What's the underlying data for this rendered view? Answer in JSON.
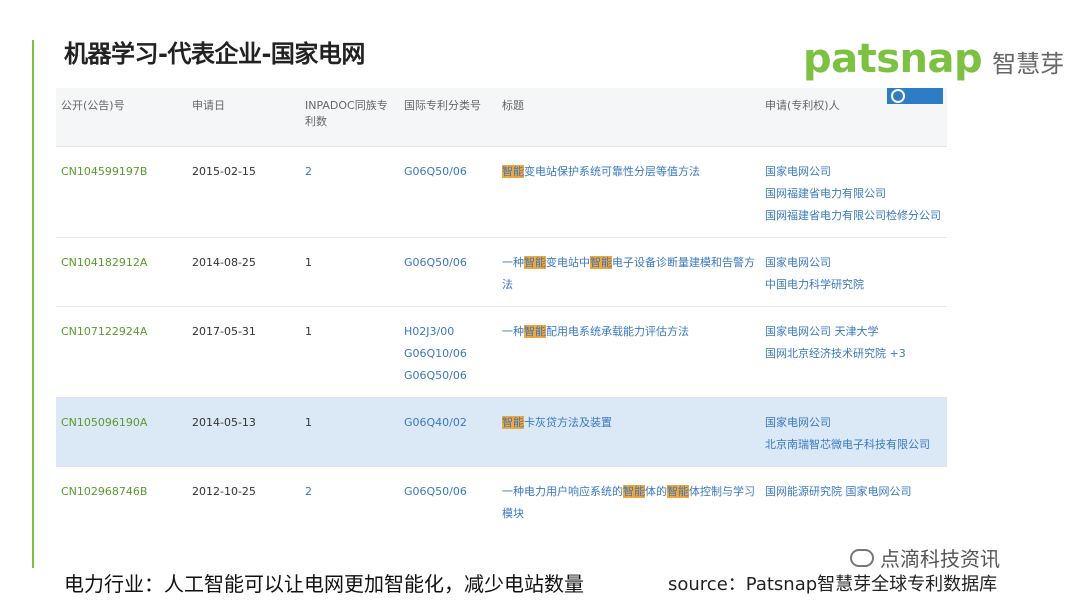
{
  "title": "机器学习-代表企业-国家电网",
  "logo": {
    "word": "patsnap",
    "cn": "智慧芽"
  },
  "table": {
    "headers": [
      "公开(公告)号",
      "申请日",
      "INPADOC同族专利数",
      "国际专利分类号",
      "标题",
      "申请(专利权)人"
    ],
    "rows": [
      {
        "pub": "CN104599197B",
        "date": "2015-02-15",
        "count": "2",
        "ipc": [
          "G06Q50/06"
        ],
        "title_parts": [
          {
            "hl": true,
            "t": "智能"
          },
          {
            "hl": false,
            "t": "变电站保护系统可靠性分层等值方法"
          }
        ],
        "applicants": [
          "国家电网公司",
          "国网福建省电力有限公司",
          "国网福建省电力有限公司检修分公司"
        ]
      },
      {
        "pub": "CN104182912A",
        "date": "2014-08-25",
        "count": "1",
        "ipc": [
          "G06Q50/06"
        ],
        "title_parts": [
          {
            "hl": false,
            "t": "一种"
          },
          {
            "hl": true,
            "t": "智能"
          },
          {
            "hl": false,
            "t": "变电站中"
          },
          {
            "hl": true,
            "t": "智能"
          },
          {
            "hl": false,
            "t": "电子设备诊断量建模和告警方法"
          }
        ],
        "applicants": [
          "国家电网公司",
          "中国电力科学研究院"
        ]
      },
      {
        "pub": "CN107122924A",
        "date": "2017-05-31",
        "count": "1",
        "ipc": [
          "H02J3/00",
          "G06Q10/06",
          "G06Q50/06"
        ],
        "title_parts": [
          {
            "hl": false,
            "t": "一种"
          },
          {
            "hl": true,
            "t": "智能"
          },
          {
            "hl": false,
            "t": "配用电系统承载能力评估方法"
          }
        ],
        "applicants": [
          "国家电网公司 天津大学",
          "国网北京经济技术研究院 +3"
        ]
      },
      {
        "pub": "CN105096190A",
        "date": "2014-05-13",
        "count": "1",
        "ipc": [
          "G06Q40/02"
        ],
        "title_parts": [
          {
            "hl": true,
            "t": "智能"
          },
          {
            "hl": false,
            "t": "卡灰贷方法及装置"
          }
        ],
        "applicants": [
          "国家电网公司",
          "北京南瑞智芯微电子科技有限公司"
        ],
        "highlight": true
      },
      {
        "pub": "CN102968746B",
        "date": "2012-10-25",
        "count": "2",
        "ipc": [
          "G06Q50/06"
        ],
        "title_parts": [
          {
            "hl": false,
            "t": "一种电力用户响应系统的"
          },
          {
            "hl": true,
            "t": "智能"
          },
          {
            "hl": false,
            "t": "体的"
          },
          {
            "hl": true,
            "t": "智能"
          },
          {
            "hl": false,
            "t": "体控制与学习模块"
          }
        ],
        "applicants": [
          "国网能源研究院 国家电网公司"
        ]
      }
    ]
  },
  "caption": "电力行业：人工智能可以让电网更加智能化，减少电站数量",
  "source": "source：Patsnap智慧芽全球专利数据库",
  "watermark": {
    "wechat": "点滴科技资讯"
  },
  "colors": {
    "accent": "#7cc142",
    "link": "#3a78c2",
    "highlight": "#f3a738",
    "row_highlight": "#dbe9f7"
  }
}
